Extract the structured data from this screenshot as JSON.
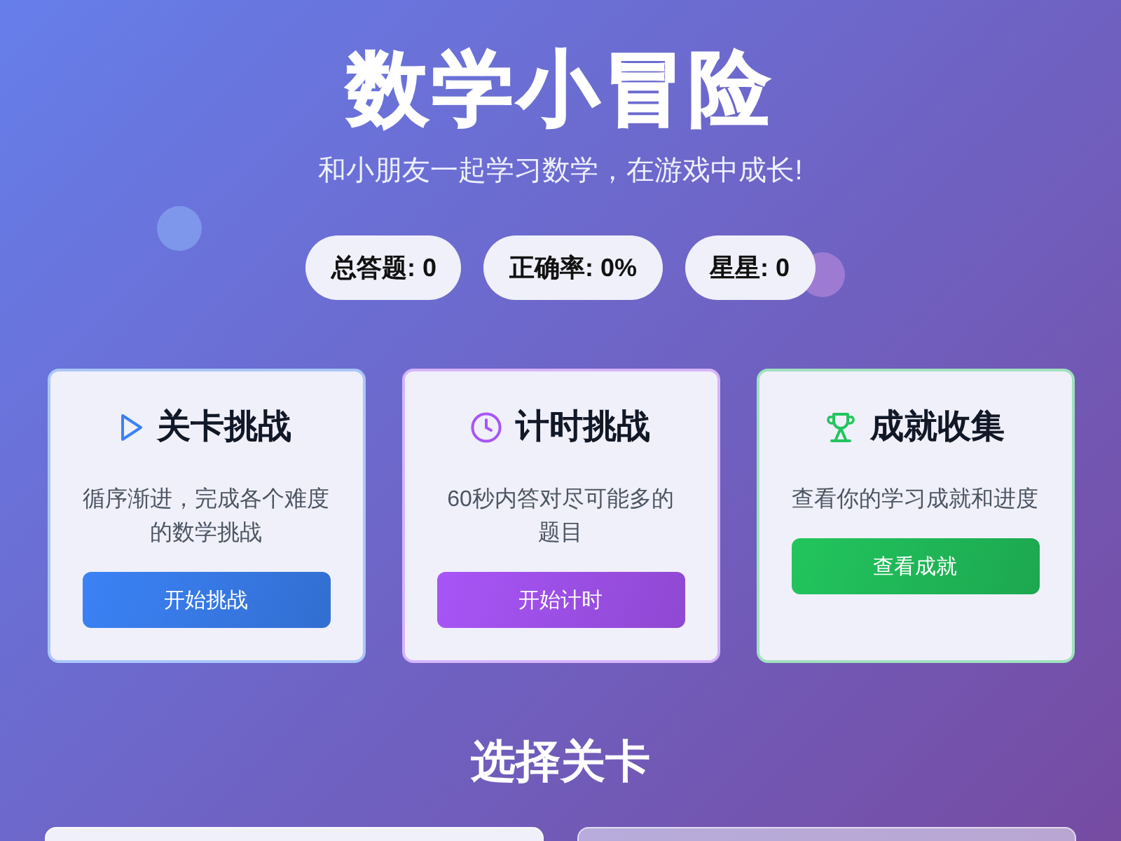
{
  "header": {
    "title": "数学小冒险",
    "subtitle": "和小朋友一起学习数学，在游戏中成长!"
  },
  "stats": [
    "总答题: 0",
    "正确率: 0%",
    "星星: 0"
  ],
  "modes": [
    {
      "kind": "level",
      "title": "关卡挑战",
      "description": "循序渐进，完成各个难度的数学挑战",
      "button": "开始挑战",
      "color": "#3b82f6"
    },
    {
      "kind": "timer",
      "title": "计时挑战",
      "description": "60秒内答对尽可能多的题目",
      "button": "开始计时",
      "color": "#a855f7"
    },
    {
      "kind": "achievement",
      "title": "成就收集",
      "description": "查看你的学习成就和进度",
      "button": "查看成就",
      "color": "#22c55e"
    }
  ],
  "level_section": {
    "title": "选择关卡",
    "levels": [
      {
        "locked": false
      },
      {
        "locked": true
      }
    ]
  }
}
